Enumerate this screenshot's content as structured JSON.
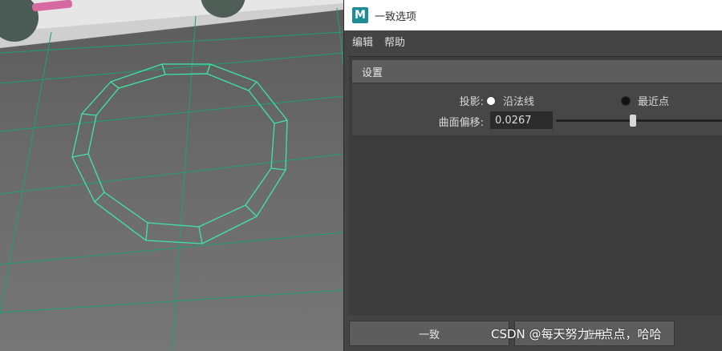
{
  "window": {
    "title": "一致选项",
    "icon_letter": "M"
  },
  "menu": {
    "items": [
      "编辑",
      "帮助"
    ]
  },
  "section": {
    "title": "设置"
  },
  "projection": {
    "label": "投影:",
    "options": [
      {
        "label": "沿法线",
        "selected": true
      },
      {
        "label": "最近点",
        "selected": false
      }
    ]
  },
  "surface_offset": {
    "label": "曲面偏移:",
    "value": "0.0267",
    "slider_fraction": 0.46
  },
  "buttons": {
    "apply_close": "一致",
    "apply": "应用"
  },
  "watermark": "CSDN @每天努力一点点，哈哈",
  "colors": {
    "wire": "#3fe6a4",
    "grid": "#1fa074",
    "accent": "#1e8c96"
  }
}
